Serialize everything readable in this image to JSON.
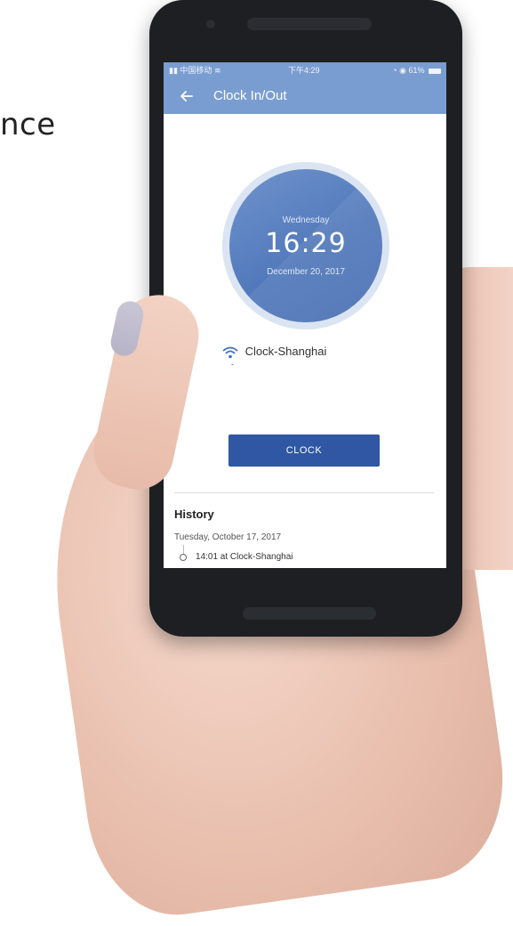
{
  "background": {
    "word_fragment": "nce"
  },
  "status_bar": {
    "carrier": "中国移动",
    "time": "下午4:29",
    "battery": "61%"
  },
  "app_bar": {
    "back_icon": "arrow-left-icon",
    "title": "Clock In/Out"
  },
  "clock": {
    "weekday": "Wednesday",
    "time": "16:29",
    "date": "December 20, 2017"
  },
  "wifi": {
    "icon": "wifi-icon",
    "network": "Clock-Shanghai",
    "sub": "-"
  },
  "clock_button": {
    "label": "CLOCK"
  },
  "history": {
    "title": "History",
    "groups": [
      {
        "date": "Tuesday, October 17, 2017",
        "entries": [
          {
            "text": "14:01 at Clock-Shanghai"
          }
        ]
      }
    ]
  },
  "colors": {
    "app_bar": "#7a9dd1",
    "clock_face": "#5279bb",
    "clock_button": "#2f57a3"
  }
}
